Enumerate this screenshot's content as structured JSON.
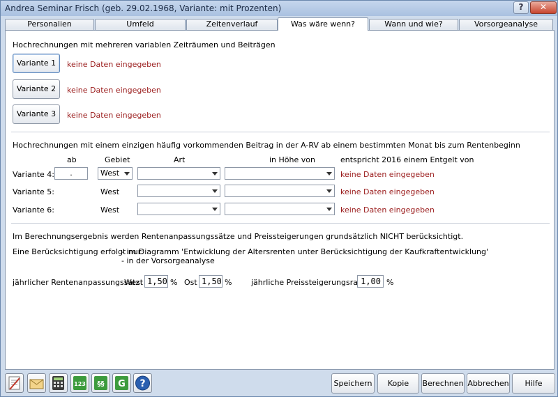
{
  "window": {
    "title": "Andrea Seminar Frisch (geb. 29.02.1968, Variante: mit Prozenten)",
    "help_glyph": "?",
    "close_glyph": "✕"
  },
  "tabs": [
    {
      "label": "Personalien"
    },
    {
      "label": "Umfeld"
    },
    {
      "label": "Zeitenverlauf"
    },
    {
      "label": "Was wäre wenn?",
      "active": true
    },
    {
      "label": "Wann und wie?"
    },
    {
      "label": "Vorsorgeanalyse"
    }
  ],
  "section1": {
    "heading": "Hochrechnungen mit mehreren variablen Zeiträumen und Beiträgen",
    "variants": [
      {
        "label": "Variante 1",
        "status": "keine Daten eingegeben"
      },
      {
        "label": "Variante 2",
        "status": "keine Daten eingegeben"
      },
      {
        "label": "Variante 3",
        "status": "keine Daten eingegeben"
      }
    ]
  },
  "section2": {
    "heading": "Hochrechnungen mit einem einzigen häufig vorkommenden Beitrag in der A-RV ab einem bestimmten Monat bis zum Rentenbeginn",
    "columns": {
      "ab": "ab",
      "gebiet": "Gebiet",
      "art": "Art",
      "hoehe": "in Höhe von",
      "entgelt": "entspricht 2016 einem Entgelt von"
    },
    "rows": [
      {
        "label": "Variante 4:",
        "ab": ".",
        "gebiet": "West",
        "art": "",
        "hoehe": "",
        "status": "keine Daten eingegeben"
      },
      {
        "label": "Variante 5:",
        "gebiet": "West",
        "art": "",
        "hoehe": "",
        "status": "keine Daten eingegeben"
      },
      {
        "label": "Variante 6:",
        "gebiet": "West",
        "art": "",
        "hoehe": "",
        "status": "keine Daten eingegeben"
      }
    ]
  },
  "section3": {
    "note": "Im Berechnungsergebnis werden Rentenanpassungssätze und Preissteigerungen grundsätzlich NICHT berücksichtigt.",
    "consider_label": "Eine Berücksichtigung erfolgt nur:",
    "consider_items": [
      "- im Diagramm 'Entwicklung der Altersrenten unter Berücksichtigung der Kaufkraftentwicklung'",
      "- in der Vorsorgeanalyse"
    ],
    "rentenanpassung_label": "jährlicher Rentenanpassungssatz",
    "west_label": "West",
    "west_value": "1,50",
    "ost_label": "Ost",
    "ost_value": "1,50",
    "percent": "%",
    "preis_label": "jährliche Preissteigerungsrate",
    "preis_value": "1,00"
  },
  "toolbar": {
    "buttons": [
      {
        "label": "Speichern"
      },
      {
        "label": "Kopie"
      },
      {
        "label": "Berechnen"
      },
      {
        "label": "Abbrechen"
      },
      {
        "label": "Hilfe"
      }
    ],
    "icon_glyphs": {
      "numbers": "123",
      "paragraph": "§§",
      "letter": "G",
      "help": "?"
    }
  },
  "colors": {
    "accent": "#2a5fb0",
    "status_red": "#9a1b1b",
    "window_bg": "#cfdcec"
  }
}
